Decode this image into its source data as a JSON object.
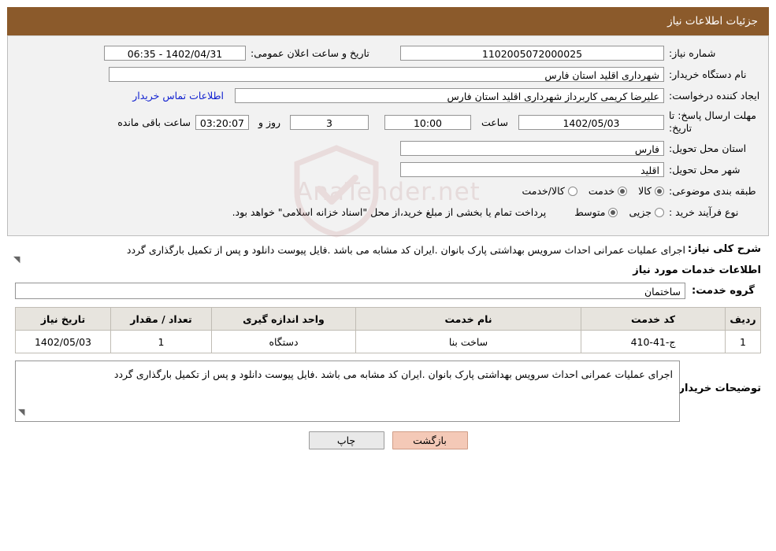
{
  "header": {
    "title": "جزئیات اطلاعات نیاز"
  },
  "form": {
    "need_number_label": "شماره نیاز:",
    "need_number_value": "1102005072000025",
    "announce_datetime_label": "تاریخ و ساعت اعلان عمومی:",
    "announce_datetime_value": "1402/04/31 - 06:35",
    "buyer_org_label": "نام دستگاه خریدار:",
    "buyer_org_value": "شهرداری اقلید استان فارس",
    "creator_label": "ایجاد کننده درخواست:",
    "creator_value": "علیرضا کریمی  کاربرداز شهرداری اقلید استان فارس",
    "contact_link": "اطلاعات تماس خریدار",
    "deadline_label": "مهلت ارسال پاسخ: تا تاریخ:",
    "deadline_date": "1402/05/03",
    "hour_label": "ساعت",
    "deadline_time": "10:00",
    "days_value": "3",
    "days_and_label": "روز و",
    "remaining_time": "03:20:07",
    "remaining_label": "ساعت باقی مانده",
    "province_label": "استان محل تحویل:",
    "province_value": "فارس",
    "city_label": "شهر محل تحویل:",
    "city_value": "اقلید",
    "category_label": "طبقه بندی موضوعی:",
    "category_options": [
      {
        "label": "کالا",
        "selected": true
      },
      {
        "label": "خدمت",
        "selected": true
      },
      {
        "label": "کالا/خدمت",
        "selected": false
      }
    ],
    "process_label": "نوع فرآیند خرید :",
    "process_options": [
      {
        "label": "جزیی",
        "selected": false
      },
      {
        "label": "متوسط",
        "selected": true
      }
    ],
    "process_note": "پرداخت تمام یا بخشی از مبلغ خرید،از محل \"اسناد خزانه اسلامی\" خواهد بود."
  },
  "watermark": {
    "text": "AnaTender.net"
  },
  "description": {
    "label": "شرح کلی نیاز:",
    "text": "اجرای عملیات عمرانی احداث سرویس بهداشتی پارک بانوان .ایران کد مشابه می باشد .فایل پیوست دانلود و پس از تکمیل بارگذاری گردد"
  },
  "services_section": {
    "title": "اطلاعات خدمات مورد نیاز",
    "group_label": "گروه خدمت:",
    "group_value": "ساختمان"
  },
  "table": {
    "headers": [
      "ردیف",
      "کد خدمت",
      "نام خدمت",
      "واحد اندازه گیری",
      "تعداد / مقدار",
      "تاریخ نیاز"
    ],
    "rows": [
      {
        "row": "1",
        "code": "ج-41-410",
        "name": "ساخت بنا",
        "unit": "دستگاه",
        "qty": "1",
        "date": "1402/05/03"
      }
    ]
  },
  "buyer_note": {
    "label": "توضیحات خریدار:",
    "text": "اجرای عملیات عمرانی احداث سرویس بهداشتی پارک بانوان .ایران کد مشابه می باشد .فایل پیوست دانلود و پس از تکمیل بارگذاری گردد"
  },
  "footer": {
    "print_label": "چاپ",
    "back_label": "بازگشت"
  }
}
